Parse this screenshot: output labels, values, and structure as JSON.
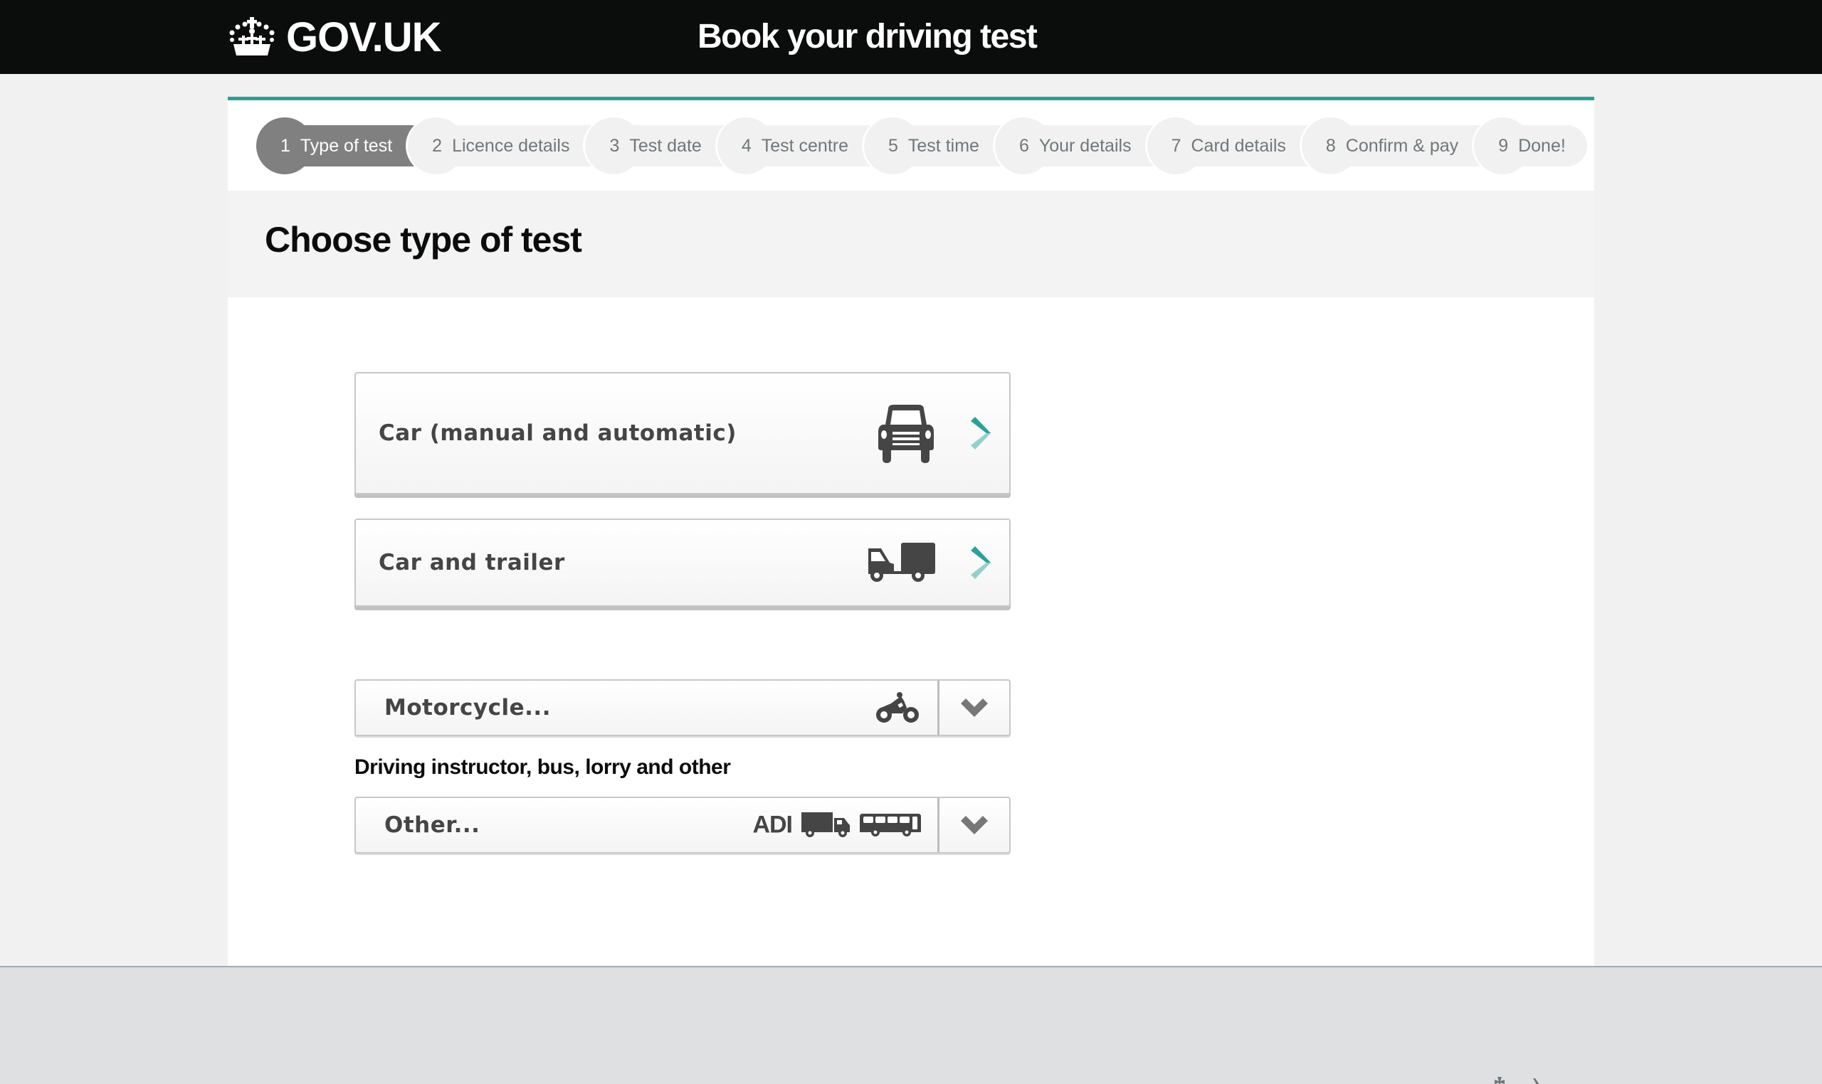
{
  "header": {
    "logo_text": "GOV.UK",
    "logo_icon": "crown-icon",
    "service_name": "Book your driving test"
  },
  "stepper": {
    "active_step": 1,
    "steps": [
      {
        "num": "1",
        "label": "Type of test"
      },
      {
        "num": "2",
        "label": "Licence details"
      },
      {
        "num": "3",
        "label": "Test date"
      },
      {
        "num": "4",
        "label": "Test centre"
      },
      {
        "num": "5",
        "label": "Test time"
      },
      {
        "num": "6",
        "label": "Your details"
      },
      {
        "num": "7",
        "label": "Card details"
      },
      {
        "num": "8",
        "label": "Confirm & pay"
      },
      {
        "num": "9",
        "label": "Done!"
      }
    ]
  },
  "page": {
    "title": "Choose type of test"
  },
  "options": {
    "car": {
      "label": "Car (manual and automatic)",
      "icon": "car-icon",
      "arrow_icon": "chevron-right-icon"
    },
    "car_trailer": {
      "label": "Car and trailer",
      "icon": "van-trailer-icon",
      "arrow_icon": "chevron-right-icon"
    },
    "motorcycle": {
      "label": "Motorcycle...",
      "icon": "motorcycle-icon",
      "arrow_icon": "chevron-down-icon"
    },
    "other_group_label": "Driving instructor, bus, lorry and other",
    "other": {
      "label": "Other...",
      "badge": "ADI",
      "icons": [
        "lorry-icon",
        "bus-icon"
      ],
      "arrow_icon": "chevron-down-icon"
    }
  },
  "colors": {
    "header_bg": "#0b0c0c",
    "accent_teal": "#28a197",
    "step_active": "#808080",
    "step_inactive": "#f1f1f1",
    "footer_bg": "#dee0e2"
  }
}
